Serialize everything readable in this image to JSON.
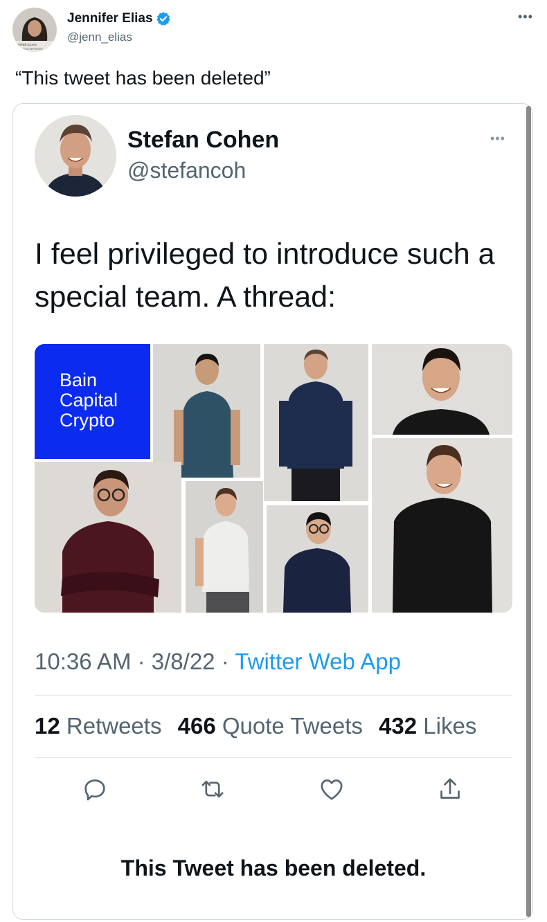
{
  "outer_tweet": {
    "author_name": "Jennifer Elias",
    "author_handle": "@jenn_elias",
    "verified": true,
    "text": "“This tweet has been deleted”",
    "avatar_caption_line1": "NNIFER ELIAS",
    "avatar_caption_line2": "CNBC TECH REPORTER"
  },
  "quoted_tweet": {
    "author_name": "Stefan Cohen",
    "author_handle": "@stefancoh",
    "text": "I feel privileged to introduce such a special team. A thread:",
    "image_brand_lines": [
      "Bain",
      "Capital",
      "Crypto"
    ],
    "time": "10:36 AM",
    "date": "3/8/22",
    "separator": "·",
    "source_app": "Twitter Web App",
    "stats": {
      "retweets_count": "12",
      "retweets_label": "Retweets",
      "quotes_count": "466",
      "quotes_label": "Quote Tweets",
      "likes_count": "432",
      "likes_label": "Likes"
    },
    "actions": [
      "reply-icon",
      "retweet-icon",
      "like-icon",
      "share-icon"
    ],
    "deleted_notice": "This Tweet has been deleted."
  },
  "colors": {
    "link_blue": "#1d9bf0",
    "verified_blue": "#1d9bf0",
    "brand_blue": "#0b2cf0",
    "secondary_text": "#536471"
  }
}
